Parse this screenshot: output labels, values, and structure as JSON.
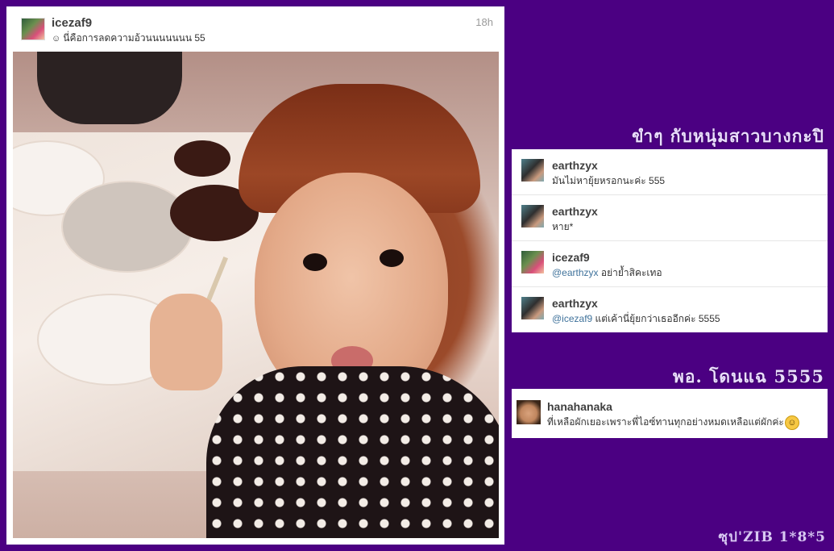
{
  "post": {
    "username": "icezaf9",
    "caption_emoji": "☺",
    "caption": "นี่คือการลดความอ้วนนนนนนน 55",
    "time": "18h"
  },
  "section_titles": {
    "first": "ขำๆ กับหนุ่มสาวบางกะปิ",
    "second": "พอ. โดนแฉ 5555"
  },
  "comments_first": [
    {
      "user": "earthzyx",
      "mention": "",
      "text": "มันไม่หายุ้ยหรอกนะค่ะ 555"
    },
    {
      "user": "earthzyx",
      "mention": "",
      "text": "หาย*"
    },
    {
      "user": "icezaf9",
      "mention": "@earthzyx",
      "text": " อย่าย้ำสิคะเทอ"
    },
    {
      "user": "earthzyx",
      "mention": "@icezaf9",
      "text": " แต่เค้านี่ยุ้ยกว่าเธออีกค่ะ 5555"
    }
  ],
  "comments_second": [
    {
      "user": "hanahanaka",
      "text": "ที่เหลือผักเยอะเพราะพี่ไอซ์ทานทุกอย่างหมดเหลือแต่ผักค่ะ",
      "emoji": "☺"
    }
  ],
  "watermark": "ซุป'ZIB 1*8*5",
  "colors": {
    "background": "#4b0082",
    "username": "#3f3f3f",
    "mention": "#3f729b",
    "time": "#9a9a9a"
  },
  "icons": {
    "post_avatar": "user-avatar-icon",
    "caption_emoji": "smiley-emoji-icon",
    "comment_emoji": "smiley-emoji-icon"
  }
}
